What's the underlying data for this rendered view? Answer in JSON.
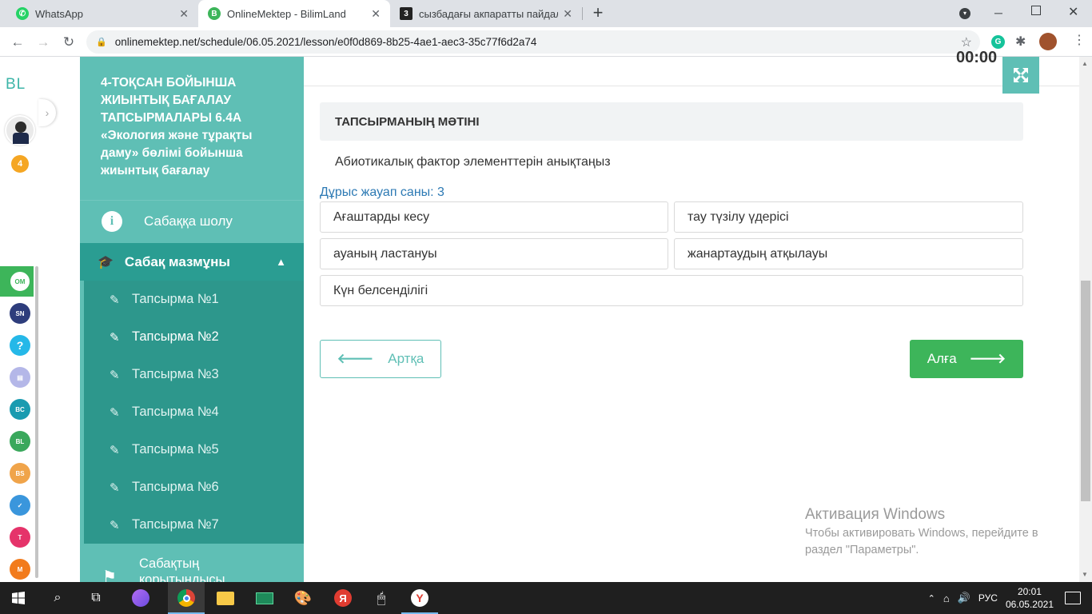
{
  "browser": {
    "tabs": [
      {
        "title": "WhatsApp",
        "active": false
      },
      {
        "title": "OnlineMektep - BilimLand",
        "active": true
      },
      {
        "title": "сызбадағы акпаратты пайдала",
        "active": false
      }
    ],
    "new_tab": "+",
    "url": "onlinemektep.net/schedule/06.05.2021/lesson/e0f0d869-8b25-4ae1-aec3-35c77f6d2a74"
  },
  "rail": {
    "logo": "BL",
    "badge_count": "4"
  },
  "sidebar": {
    "course_title": "4-ТОҚСАН БОЙЫНША ЖИЫНТЫҚ БАҒАЛАУ ТАПСЫРМАЛАРЫ 6.4А «Экология және тұрақты даму» бөлімі бойынша жиынтық бағалау",
    "overview": "Сабаққа шолу",
    "content": "Сабақ мазмұны",
    "tasks": [
      "Тапсырма №1",
      "Тапсырма №2",
      "Тапсырма №3",
      "Тапсырма №4",
      "Тапсырма №5",
      "Тапсырма №6",
      "Тапсырма №7"
    ],
    "current_task_index": 1,
    "summary": "Сабақтың қорытындысы"
  },
  "main": {
    "timer": "00:00",
    "task_header": "ТАПСЫРМАНЫҢ МӘТІНІ",
    "task_text": "Абиотикалық фактор элементтерін анықтаңыз",
    "answer_count": "Дұрыс жауап саны: 3",
    "options": [
      "Ағаштарды кесу",
      "тау түзілу үдерісі",
      "ауаның ластануы",
      "жанартаудың атқылауы",
      "Күн белсенділігі"
    ],
    "back_label": "Артқа",
    "next_label": "Алға"
  },
  "windows_activation": {
    "title": "Активация Windows",
    "text": "Чтобы активировать Windows, перейдите в раздел \"Параметры\"."
  },
  "taskbar": {
    "lang": "РУС",
    "time": "20:01",
    "date": "06.05.2021"
  },
  "colors": {
    "teal": "#5fbfb5",
    "teal_dark": "#2a9d92",
    "green": "#3db55a",
    "link_blue": "#2d7ab4"
  }
}
